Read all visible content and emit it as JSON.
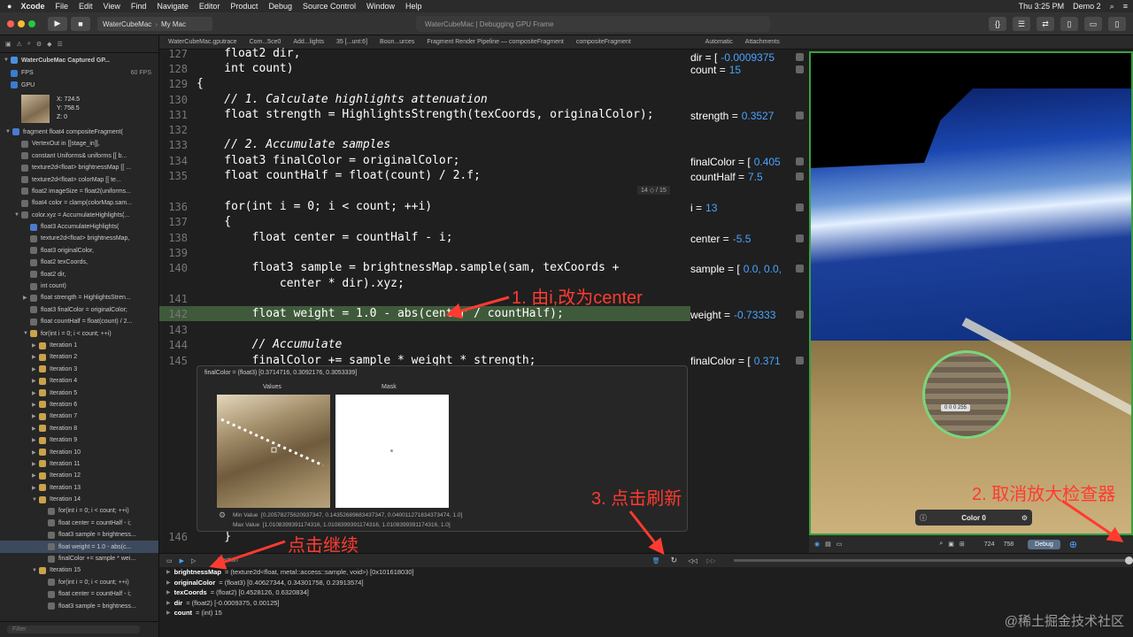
{
  "menubar": {
    "apple": "",
    "app": "Xcode",
    "items": [
      "File",
      "Edit",
      "View",
      "Find",
      "Navigate",
      "Editor",
      "Product",
      "Debug",
      "Source Control",
      "Window",
      "Help"
    ],
    "clock": "Thu 3:25 PM",
    "user": "Demo 2"
  },
  "toolbar": {
    "scheme": "WaterCubeMac",
    "device": "My Mac",
    "status": "WaterCubeMac  |  Debugging GPU Frame"
  },
  "jumpbar": [
    "WaterCubeMac.gputrace",
    "Com...5ce0",
    "Add...lights",
    "35 [...unt:6]",
    "Boun...urces",
    "Fragment Render Pipeline — compositeFragment",
    "compositeFragment",
    "Automatic",
    "Attachments"
  ],
  "navigator": {
    "title": "WaterCubeMac Captured GP...",
    "fps": "FPS",
    "fps_value": "60 FPS",
    "gpu": "GPU",
    "thumb_x": "X:  724.5",
    "thumb_y": "Y:  758.5",
    "thumb_z": "Z:  0",
    "rows": [
      {
        "t": "fragment float4 compositeFragment(",
        "i": "f",
        "d": 0,
        "tri": "▼"
      },
      {
        "t": "VertexOut in [[stage_in]],",
        "i": "",
        "d": 1
      },
      {
        "t": "constant Uniforms& uniforms   [[ b...",
        "i": "",
        "d": 1
      },
      {
        "t": "texture2d<float> brightnessMap [[ ...",
        "i": "",
        "d": 1
      },
      {
        "t": "texture2d<float> colorMap   [[ te...",
        "i": "",
        "d": 1
      },
      {
        "t": "float2 imageSize = float2(uniforms...",
        "i": "",
        "d": 1
      },
      {
        "t": "float4 color = clamp(colorMap.sam...",
        "i": "",
        "d": 1
      },
      {
        "t": "color.xyz = AccumulateHighlights(...",
        "i": "",
        "d": 1,
        "tri": "▼"
      },
      {
        "t": "float3 AccumulateHighlights(",
        "i": "f",
        "d": 2
      },
      {
        "t": "texture2d<float> brightnessMap,",
        "i": "",
        "d": 2
      },
      {
        "t": "float3 originalColor,",
        "i": "",
        "d": 2
      },
      {
        "t": "float2 texCoords,",
        "i": "",
        "d": 2
      },
      {
        "t": "float2 dir,",
        "i": "",
        "d": 2
      },
      {
        "t": "int count)",
        "i": "",
        "d": 2
      },
      {
        "t": "float strength = HighlightsStren...",
        "i": "",
        "d": 2,
        "tri": "▶"
      },
      {
        "t": "float3 finalColor = originalColor;",
        "i": "",
        "d": 2
      },
      {
        "t": "float countHalf = float(count) / 2...",
        "i": "",
        "d": 2
      },
      {
        "t": "for(int i = 0; i < count; ++i)",
        "i": "y",
        "d": 2,
        "tri": "▼"
      },
      {
        "t": "Iteration 1",
        "i": "y",
        "d": 3,
        "tri": "▶"
      },
      {
        "t": "Iteration 2",
        "i": "y",
        "d": 3,
        "tri": "▶"
      },
      {
        "t": "Iteration 3",
        "i": "y",
        "d": 3,
        "tri": "▶"
      },
      {
        "t": "Iteration 4",
        "i": "y",
        "d": 3,
        "tri": "▶"
      },
      {
        "t": "Iteration 5",
        "i": "y",
        "d": 3,
        "tri": "▶"
      },
      {
        "t": "Iteration 6",
        "i": "y",
        "d": 3,
        "tri": "▶"
      },
      {
        "t": "Iteration 7",
        "i": "y",
        "d": 3,
        "tri": "▶"
      },
      {
        "t": "Iteration 8",
        "i": "y",
        "d": 3,
        "tri": "▶"
      },
      {
        "t": "Iteration 9",
        "i": "y",
        "d": 3,
        "tri": "▶"
      },
      {
        "t": "Iteration 10",
        "i": "y",
        "d": 3,
        "tri": "▶"
      },
      {
        "t": "Iteration 11",
        "i": "y",
        "d": 3,
        "tri": "▶"
      },
      {
        "t": "Iteration 12",
        "i": "y",
        "d": 3,
        "tri": "▶"
      },
      {
        "t": "Iteration 13",
        "i": "y",
        "d": 3,
        "tri": "▶"
      },
      {
        "t": "Iteration 14",
        "i": "y",
        "d": 3,
        "tri": "▼"
      },
      {
        "t": "for(int i = 0; i < count; ++i)",
        "i": "",
        "d": 4
      },
      {
        "t": "float center = countHalf - i;",
        "i": "",
        "d": 4
      },
      {
        "t": "float3 sample = brightness...",
        "i": "",
        "d": 4
      },
      {
        "t": "float weight = 1.0 - abs(c...",
        "i": "",
        "d": 4,
        "sel": true
      },
      {
        "t": "finalColor += sample * wei...",
        "i": "",
        "d": 4
      },
      {
        "t": "Iteration 15",
        "i": "y",
        "d": 3,
        "tri": "▼"
      },
      {
        "t": "for(int i = 0; i < count; ++i)",
        "i": "",
        "d": 4
      },
      {
        "t": "float center = countHalf - i;",
        "i": "",
        "d": 4
      },
      {
        "t": "float3 sample = brightness...",
        "i": "",
        "d": 4
      }
    ],
    "filter": "Filter"
  },
  "code": [
    {
      "n": "127",
      "src": "    float2 dir,"
    },
    {
      "n": "128",
      "src": "    int count)"
    },
    {
      "n": "129",
      "src": "{"
    },
    {
      "n": "130",
      "src": "    // 1. Calculate highlights attenuation"
    },
    {
      "n": "131",
      "src": "    float strength = HighlightsStrength(texCoords, originalColor);"
    },
    {
      "n": "132",
      "src": ""
    },
    {
      "n": "133",
      "src": "    // 2. Accumulate samples"
    },
    {
      "n": "134",
      "src": "    float3 finalColor = originalColor;"
    },
    {
      "n": "135",
      "src": "    float countHalf = float(count) / 2.f;"
    },
    {
      "n": "136",
      "src": "    for(int i = 0; i < count; ++i)"
    },
    {
      "n": "137",
      "src": "    {"
    },
    {
      "n": "138",
      "src": "        float center = countHalf - i;"
    },
    {
      "n": "139",
      "src": ""
    },
    {
      "n": "140",
      "src": "        float3 sample = brightnessMap.sample(sam, texCoords +"
    },
    {
      "n": "",
      "src": "            center * dir).xyz;"
    },
    {
      "n": "141",
      "src": ""
    },
    {
      "n": "142",
      "src": "        float weight = 1.0 - abs(center / countHalf);"
    },
    {
      "n": "143",
      "src": ""
    },
    {
      "n": "144",
      "src": "        // Accumulate"
    },
    {
      "n": "145",
      "src": "        finalColor += sample * weight * strength;"
    },
    {
      "n": "146",
      "src": "    }"
    }
  ],
  "loop_badge": "14 ◇ / 15",
  "vars": [
    {
      "k": "dir = [",
      "v": "-0.0009375"
    },
    {
      "k": "count =",
      "v": "15"
    },
    {
      "k": "strength =",
      "v": "0.3527"
    },
    {
      "k": "finalColor = [",
      "v": "0.405"
    },
    {
      "k": "countHalf =",
      "v": "7.5"
    },
    {
      "k": "i =",
      "v": "13"
    },
    {
      "k": "center =",
      "v": "-5.5"
    },
    {
      "k": "sample = [",
      "v": "0.0, 0.0,"
    },
    {
      "k": "weight =",
      "v": "-0.73333"
    },
    {
      "k": "finalColor = [",
      "v": "0.371"
    }
  ],
  "popup": {
    "head": "finalColor = (float3) [0.3714716, 0.3092176, 0.3053339]",
    "values_label": "Values",
    "mask_label": "Mask",
    "min_label": "Min Value",
    "min_value": "[0.20578275620937347, 0.14352689683437347, 0.040011271834373474, 1.0]",
    "max_label": "Max Value",
    "max_value": "[1.0108399391174316, 1.0108399391174316, 1.0108399391174316, 1.0]"
  },
  "canvas": {
    "magnifier": "0   0   0 255",
    "color_label": "Color 0",
    "w": "724",
    "h": "758",
    "debug_btn": "Debug"
  },
  "debugbar": {
    "section": "Section"
  },
  "bottom_vars": [
    {
      "k": "brightnessMap",
      "v": "= (texture2d<float, metal::access::sample, void>) [0x101618030]"
    },
    {
      "k": "originalColor",
      "v": "= (float3) [0.40627344, 0.34301758, 0.23913574]"
    },
    {
      "k": "texCoords",
      "v": "= (float2) [0.4528126, 0.6320834]"
    },
    {
      "k": "dir",
      "v": "= (float2) [-0.0009375, 0.00125]"
    },
    {
      "k": "count",
      "v": "= (int) 15"
    }
  ],
  "annotations": {
    "a1": "1. 由i,改为center",
    "a2": "2. 取消放大检查器",
    "a3": "3. 点击刷新",
    "a4": "点击继续"
  },
  "watermark": "@稀土掘金技术社区"
}
